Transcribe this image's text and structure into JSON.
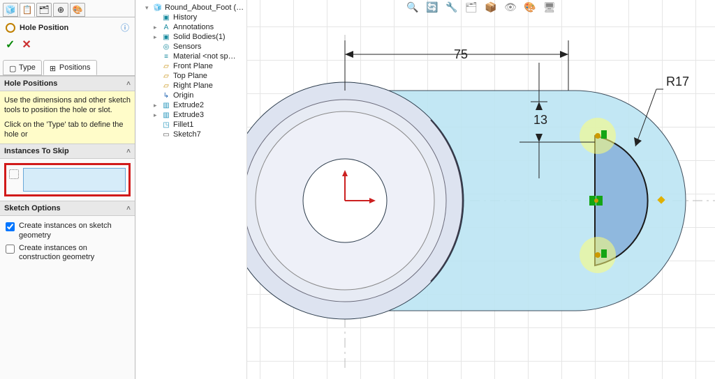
{
  "title": "Hole Position",
  "tabs": {
    "type": "Type",
    "positions": "Positions"
  },
  "hint_heading": "Hole Positions",
  "hint_body1": "Use the dimensions and other sketch tools to position the hole or slot.",
  "hint_body2": "Click on the 'Type' tab to define the hole or",
  "skip_heading": "Instances To Skip",
  "skopt_heading": "Sketch Options",
  "skopt1": "Create instances on sketch geometry",
  "skopt2": "Create instances on construction geometry",
  "tree": {
    "root": "Round_About_Foot (…",
    "items": [
      "History",
      "Annotations",
      "Solid Bodies(1)",
      "Sensors",
      "Material <not sp…",
      "Front Plane",
      "Top Plane",
      "Right Plane",
      "Origin",
      "Extrude2",
      "Extrude3",
      "Fillet1",
      "Sketch7"
    ]
  },
  "dims": {
    "d75": "75",
    "d13": "13",
    "r17": "R17"
  },
  "viewtb": [
    "🔍",
    "🔄",
    "🔧",
    "🗂",
    "📦",
    "👁",
    "🎨",
    "🖥"
  ]
}
